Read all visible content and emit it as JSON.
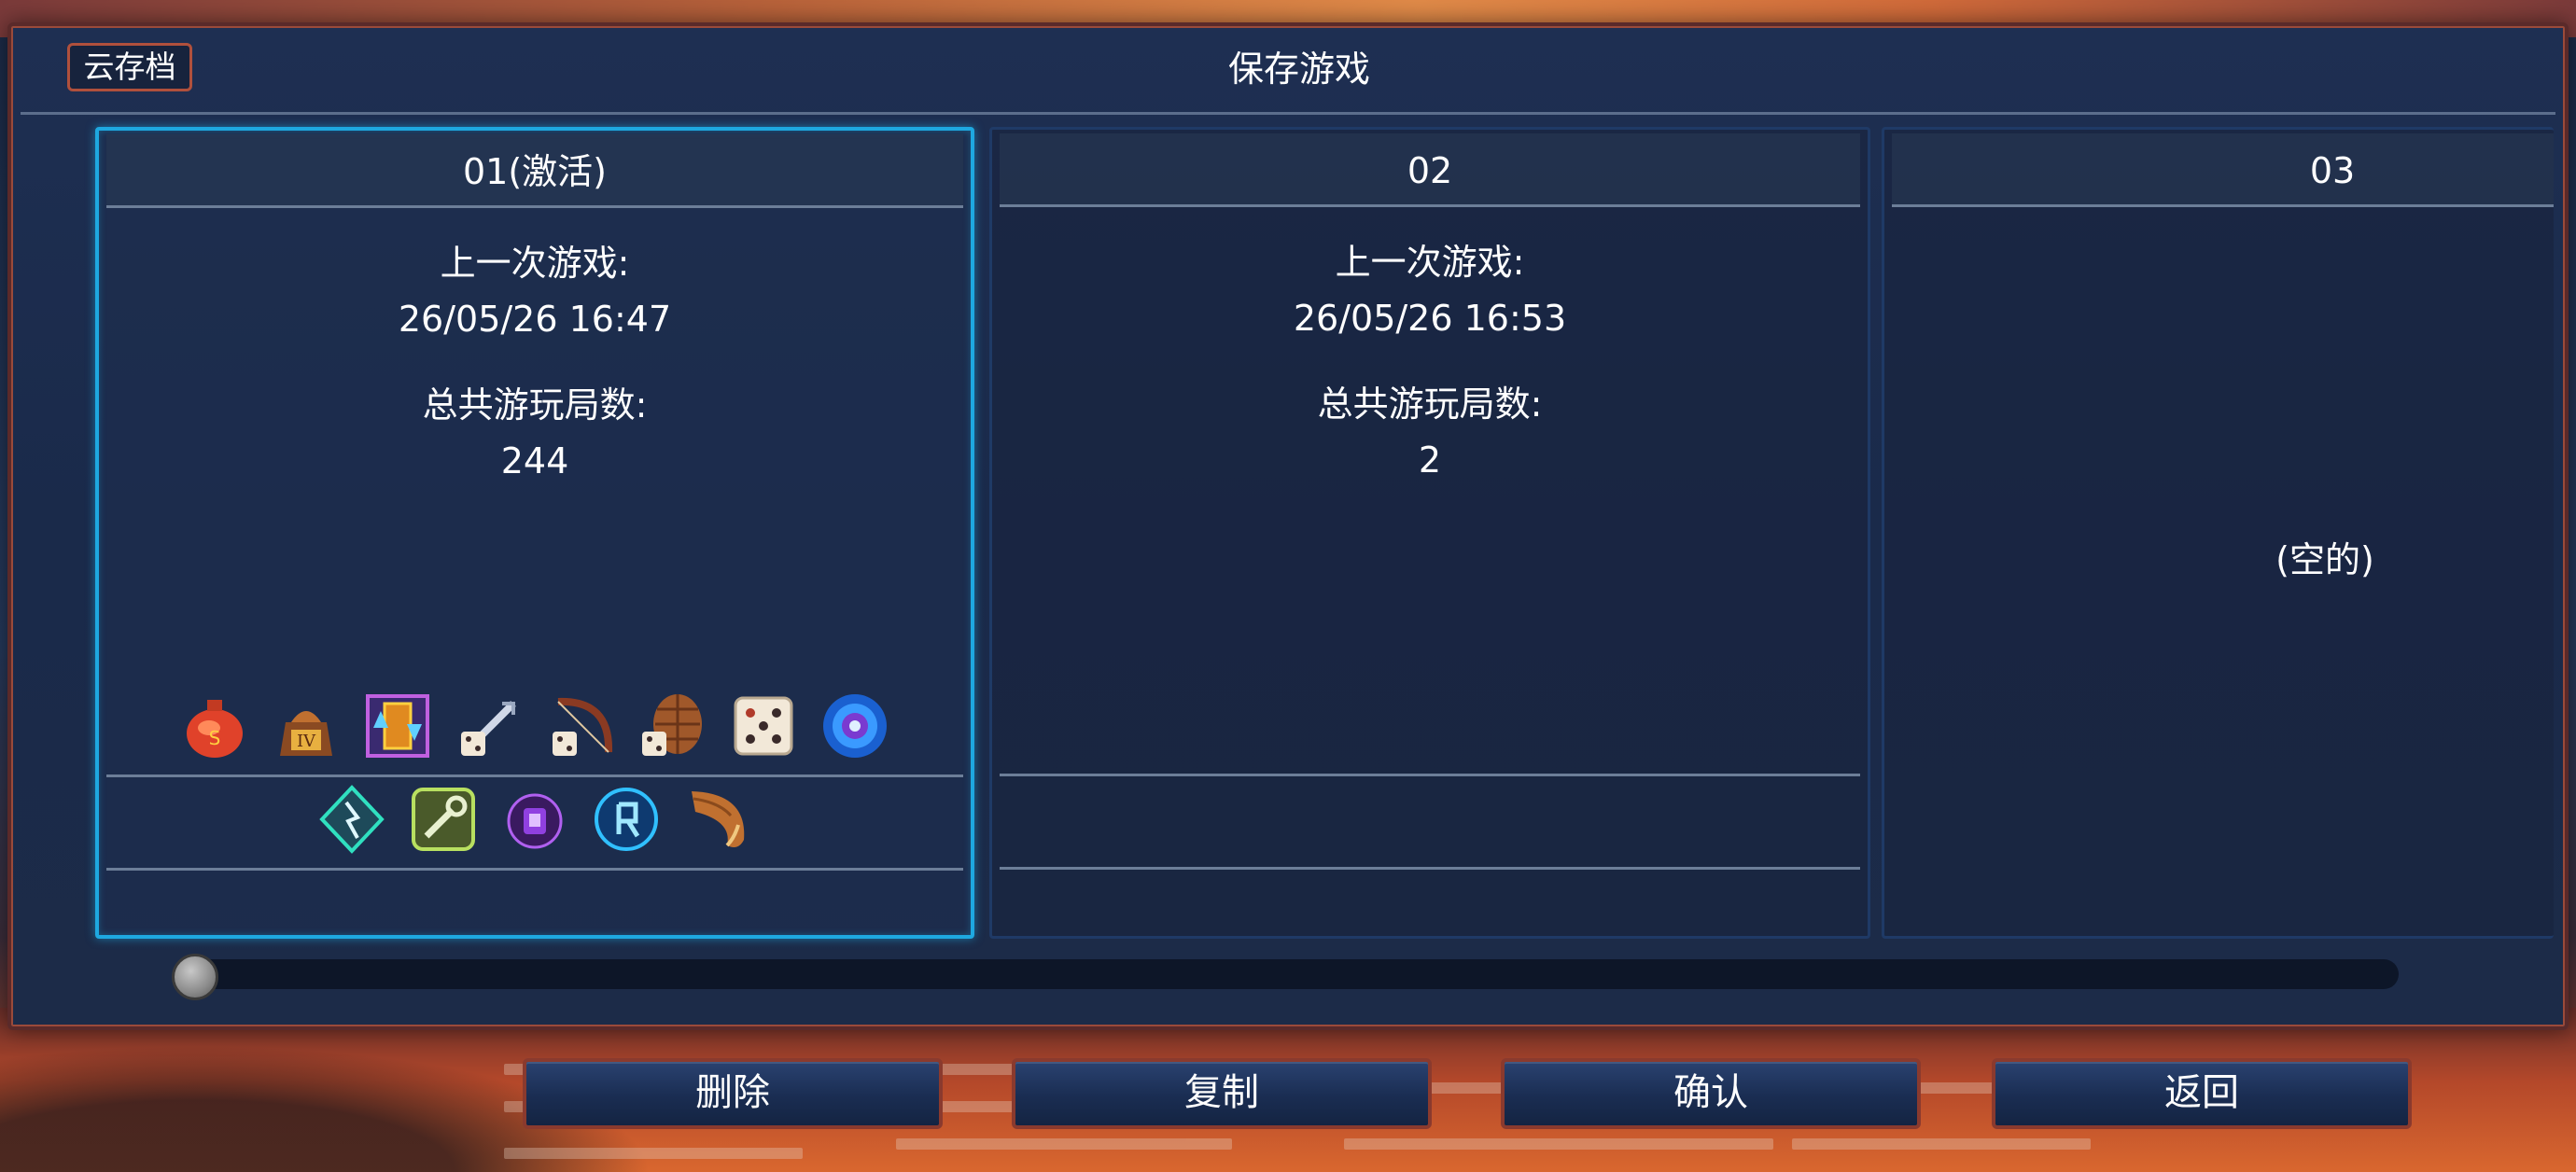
{
  "header": {
    "cloud_save_label": "云存档",
    "title": "保存游戏"
  },
  "slots": [
    {
      "number": "01(激活)",
      "last_played_label": "上一次游戏:",
      "last_played_value": "26/05/26 16:47",
      "runs_label": "总共游玩局数:",
      "runs_value": "244",
      "active": true,
      "icons_row1": [
        "red-potion-icon",
        "treasure-bag-icon",
        "double-arrow-card-icon",
        "dice-sword-icon",
        "dice-bow-icon",
        "dice-shield-icon",
        "dice-icon",
        "blue-portal-icon"
      ],
      "icons_row2": [
        "teal-rune-icon",
        "wrench-rune-icon",
        "purple-lantern-icon",
        "blue-rune-icon",
        "horn-icon"
      ]
    },
    {
      "number": "02",
      "last_played_label": "上一次游戏:",
      "last_played_value": "26/05/26 16:53",
      "runs_label": "总共游玩局数:",
      "runs_value": "2",
      "active": false
    },
    {
      "number": "03",
      "empty_label": "(空的)",
      "active": false
    }
  ],
  "scrollbar": {
    "position": 0
  },
  "buttons": {
    "delete": "删除",
    "copy": "复制",
    "confirm": "确认",
    "back": "返回"
  },
  "colors": {
    "panel_bg": "#1e2f52",
    "active_border": "#1ea8e0",
    "button_border": "#8a3a2e"
  }
}
